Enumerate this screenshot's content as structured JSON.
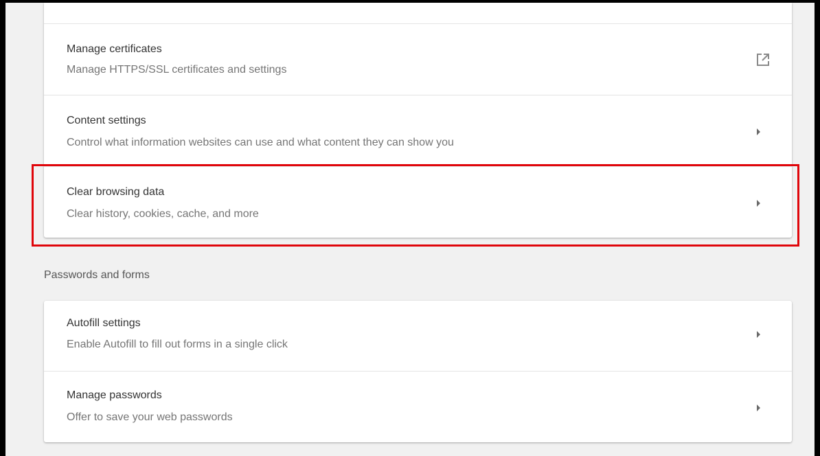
{
  "security_section": {
    "items": [
      {
        "title": "Manage certificates",
        "subtitle": "Manage HTTPS/SSL certificates and settings",
        "action_icon": "external-link-icon"
      },
      {
        "title": "Content settings",
        "subtitle": "Control what information websites can use and what content they can show you",
        "action_icon": "chevron-right-icon"
      },
      {
        "title": "Clear browsing data",
        "subtitle": "Clear history, cookies, cache, and more",
        "action_icon": "chevron-right-icon"
      }
    ]
  },
  "passwords_section": {
    "header": "Passwords and forms",
    "items": [
      {
        "title": "Autofill settings",
        "subtitle": "Enable Autofill to fill out forms in a single click",
        "action_icon": "chevron-right-icon"
      },
      {
        "title": "Manage passwords",
        "subtitle": "Offer to save your web passwords",
        "action_icon": "chevron-right-icon"
      }
    ]
  },
  "colors": {
    "highlight": "#e0060b",
    "page_background": "#f1f1f1",
    "card_background": "#ffffff",
    "title_text": "#333333",
    "subtitle_text": "#757575"
  }
}
